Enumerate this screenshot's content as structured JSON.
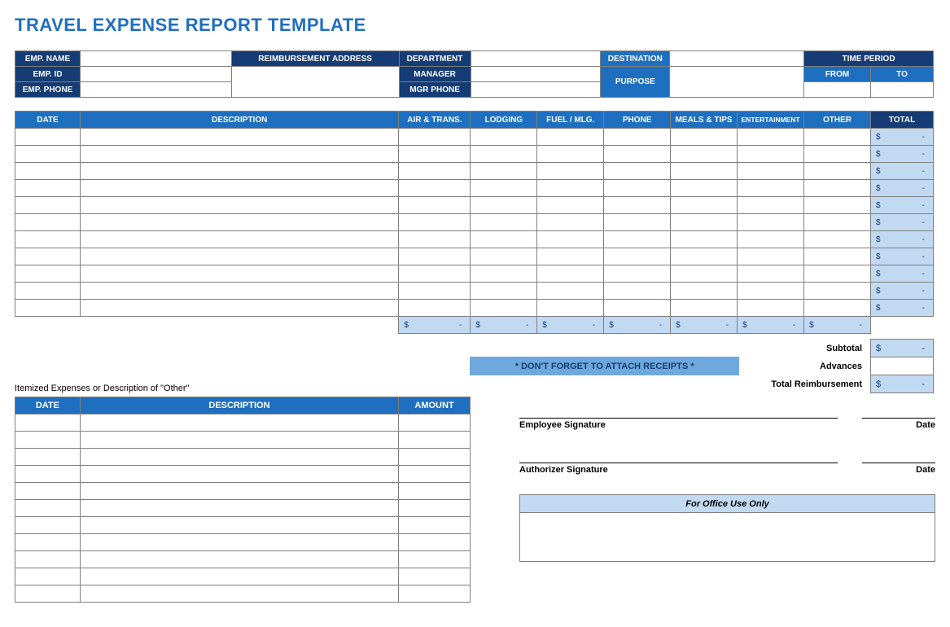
{
  "title": "TRAVEL EXPENSE REPORT TEMPLATE",
  "info": {
    "emp_name_label": "EMP. NAME",
    "emp_id_label": "EMP. ID",
    "emp_phone_label": "EMP. PHONE",
    "reimb_addr_label": "REIMBURSEMENT ADDRESS",
    "department_label": "DEPARTMENT",
    "manager_label": "MANAGER",
    "mgr_phone_label": "MGR PHONE",
    "destination_label": "DESTINATION",
    "purpose_label": "PURPOSE",
    "time_period_label": "TIME PERIOD",
    "from_label": "FROM",
    "to_label": "TO"
  },
  "grid": {
    "cols": {
      "date": "DATE",
      "description": "DESCRIPTION",
      "air": "AIR & TRANS.",
      "lodging": "LODGING",
      "fuel": "FUEL / MLG.",
      "phone": "PHONE",
      "meals": "MEALS & TIPS",
      "entertainment": "ENTERTAINMENT",
      "other": "OTHER",
      "total": "TOTAL"
    },
    "row_count": 11,
    "row_total_currency": "$",
    "row_total_value": "-",
    "col_sum_currency": "$",
    "col_sum_value": "-"
  },
  "summary": {
    "subtotal_label": "Subtotal",
    "advances_label": "Advances",
    "total_reimb_label": "Total Reimbursement",
    "receipt_note": "*  DON'T FORGET TO ATTACH RECEIPTS  *"
  },
  "itemized": {
    "caption": "Itemized Expenses or Description of \"Other\"",
    "cols": {
      "date": "DATE",
      "description": "DESCRIPTION",
      "amount": "AMOUNT"
    },
    "row_count": 11
  },
  "sign": {
    "employee": "Employee Signature",
    "authorizer": "Authorizer Signature",
    "date": "Date",
    "office": "For Office Use Only"
  }
}
